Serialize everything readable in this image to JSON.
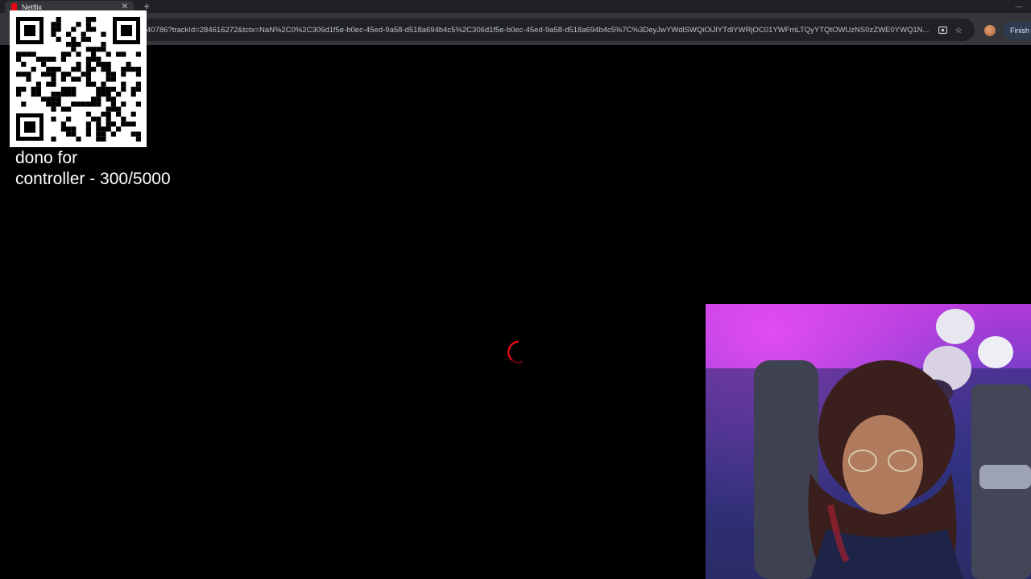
{
  "browser": {
    "tab": {
      "title": "Netflix",
      "close_icon": "close-icon"
    },
    "new_tab_icon": "plus-icon",
    "window_controls": {
      "minimize_label": "—"
    },
    "address_bar": {
      "url": "40786?trackId=284616272&tctx=NaN%2C0%2C306d1f5e-b0ec-45ed-9a58-d518a694b4c5%2C306d1f5e-b0ec-45ed-9a58-d518a694b4c5%7C%3DeyJwYWdlSWQiOiJlYTdlYWRjOC01YWFmLTQyYTQtOWUzNS0zZWE0YWQ1N..."
    },
    "finish_button_label": "Finish u",
    "accent_color": "#e50914"
  },
  "overlay": {
    "donation_text_line1": "dono for",
    "donation_text_line2": "controller - 300/5000"
  }
}
